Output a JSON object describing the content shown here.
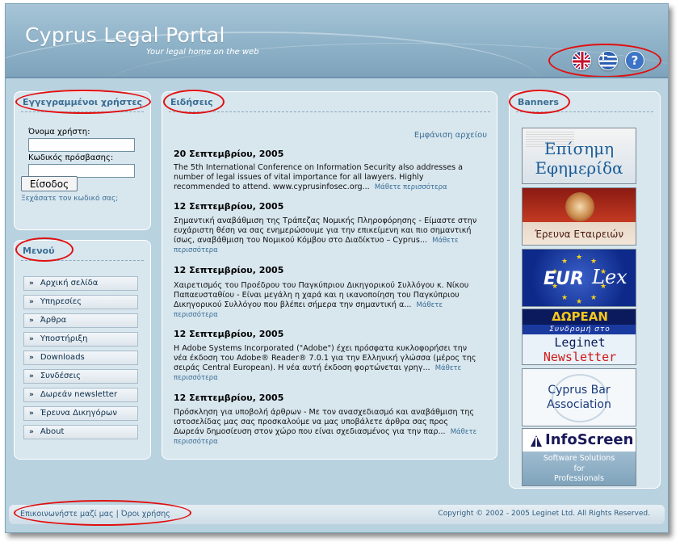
{
  "header": {
    "title": "Cyprus Legal Portal",
    "tagline": "Your legal home on the web",
    "languages": [
      "english-flag-icon",
      "greek-flag-icon",
      "help-icon"
    ],
    "help_glyph": "?"
  },
  "login": {
    "title": "Εγγεγραμμένοι χρήστες",
    "username_label": "Όνομα χρήστη:",
    "password_label": "Κωδικός πρόσβασης:",
    "submit": "Είσοδος",
    "forgot": "Ξεχάσατε τον κωδικό σας;"
  },
  "menu": {
    "title": "Μενού",
    "bullet": "»",
    "items": [
      "Αρχική σελίδα",
      "Υπηρεσίες",
      "Άρθρα",
      "Υποστήριξη",
      "Downloads",
      "Συνδέσεις",
      "Δωρεάν newsletter",
      "Έρευνα Δικηγόρων",
      "About"
    ]
  },
  "news": {
    "title": "Ειδήσεις",
    "archive": "Εμφάνιση αρχείου",
    "more": "Μάθετε περισσότερα",
    "items": [
      {
        "date": "20 Σεπτεμβρίου, 2005",
        "text": "The 5th International Conference on Information Security also addresses a number of legal issues of vital importance for all lawyers. Highly recommended to attend. www.cyprusinfosec.org..."
      },
      {
        "date": "12 Σεπτεμβρίου, 2005",
        "text": "Σημαντική αναβάθμιση της Τράπεζας Νομικής Πληροφόρησης - Είμαστε στην ευχάριστη θέση να σας ενημερώσουμε για την επικείμενη και πιο σημαντική ίσως, αναβάθμιση του Νομικού Κόμβου στο Διαδίκτυο – Cyprus..."
      },
      {
        "date": "12 Σεπτεμβρίου, 2005",
        "text": "Χαιρετισμός του Προέδρου του Παγκύπριου Δικηγορικού Συλλόγου κ. Νίκου Παπαευσταθίου - Είναι μεγάλη η χαρά και η ικανοποίηση του Παγκύπριου Δικηγορικού Συλλόγου που βλέπει σήμερα την σημαντική α..."
      },
      {
        "date": "12 Σεπτεμβρίου, 2005",
        "text": "Η Adobe Systems Incorporated (\"Adobe\") έχει πρόσφατα κυκλοφορήσει την νέα έκδοση του Adobe® Reader® 7.0.1 για την Ελληνική γλώσσα (μέρος της σειράς Central European). Η νέα αυτή έκδοση φορτώνεται γρηγ..."
      },
      {
        "date": "12 Σεπτεμβρίου, 2005",
        "text": "Πρόσκληση για υποβολή άρθρων - Με τον ανασχεδιασμό και αναβάθμιση της ιστοσελίδας μας σας προσκαλούμε να μας υποβάλετε άρθρα σας προς Δωρεάν δημοσίευση στον χώρο που είναι σχεδιασμένος για την παρ..."
      }
    ]
  },
  "banners": {
    "title": "Banners",
    "items": [
      {
        "line1": "Επίσημη",
        "line2": "Εφημερίδα"
      },
      {
        "line1": "Έρευνα Εταιρειών"
      },
      {
        "line1": "EUR",
        "line2": "Lex"
      },
      {
        "line1": "ΔΩΡΕΑΝ",
        "line2": "Συνδρομή στο",
        "line3": "Leginet",
        "line4": "Newsletter"
      },
      {
        "line1": "Cyprus Bar",
        "line2": "Association"
      },
      {
        "line1": "InfoScreen",
        "line2": "Software Solutions",
        "line3": "for",
        "line4": "Professionals"
      }
    ]
  },
  "footer": {
    "contact": "Επικοινωνήστε μαζί μας",
    "separator": "|",
    "terms": "Όροι χρήσης",
    "copyright": "Copyright © 2002 - 2005 Leginet Ltd. All Rights Reserved."
  }
}
